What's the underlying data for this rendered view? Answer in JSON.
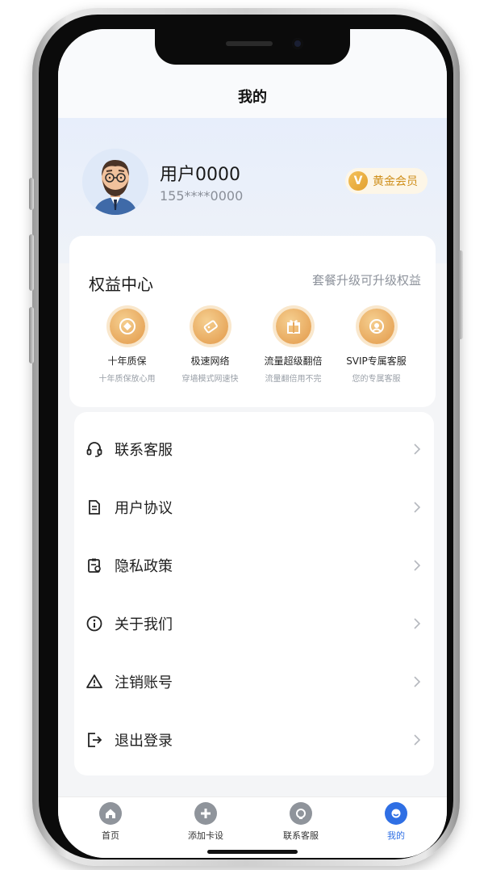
{
  "header": {
    "title": "我的"
  },
  "profile": {
    "username": "用户0000",
    "phone": "155****0000",
    "vip_letter": "V",
    "vip_label": "黄金会员"
  },
  "benefits": {
    "title": "权益中心",
    "subtitle": "套餐升级可升级权益",
    "items": [
      {
        "label": "十年质保",
        "desc": "十年质保放心用",
        "icon": "shield-icon"
      },
      {
        "label": "极速网络",
        "desc": "穿墙模式网速快",
        "icon": "ticket-icon"
      },
      {
        "label": "流量超级翻倍",
        "desc": "流量翻倍用不完",
        "icon": "gift-icon"
      },
      {
        "label": "SVIP专属客服",
        "desc": "您的专属客服",
        "icon": "service-icon"
      }
    ]
  },
  "menu": {
    "items": [
      {
        "label": "联系客服",
        "icon": "headset-icon"
      },
      {
        "label": "用户协议",
        "icon": "document-icon"
      },
      {
        "label": "隐私政策",
        "icon": "clipboard-icon"
      },
      {
        "label": "关于我们",
        "icon": "info-icon"
      },
      {
        "label": "注销账号",
        "icon": "warning-icon"
      },
      {
        "label": "退出登录",
        "icon": "logout-icon"
      }
    ]
  },
  "tabbar": {
    "items": [
      {
        "label": "首页",
        "icon": "home-icon",
        "active": false
      },
      {
        "label": "添加卡设",
        "icon": "plus-icon",
        "active": false
      },
      {
        "label": "联系客服",
        "icon": "support-icon",
        "active": false
      },
      {
        "label": "我的",
        "icon": "profile-icon",
        "active": true
      }
    ]
  },
  "colors": {
    "accent": "#2f6fe4",
    "gold": "#e7a65a",
    "vip_text": "#cf8f1b"
  }
}
